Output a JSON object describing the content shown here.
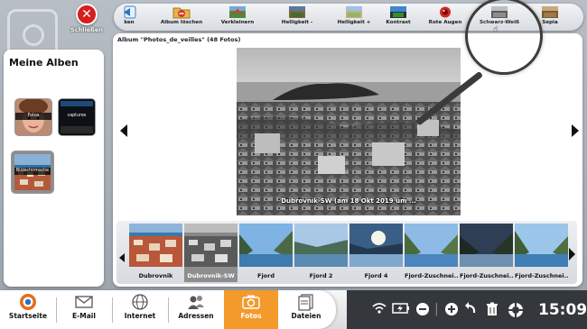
{
  "window": {
    "close_label": "Schließen"
  },
  "toolbar": {
    "items": [
      {
        "label": "ken",
        "icon": "back-arrow-icon"
      },
      {
        "label": "Album löschen",
        "icon": "folder-delete-icon"
      },
      {
        "label": "Verkleinern",
        "icon": "resize-icon"
      },
      {
        "label": "Helligkeit -",
        "icon": "brightness-down-icon"
      },
      {
        "label": "Helligkeit +",
        "icon": "brightness-up-icon"
      },
      {
        "label": "Kontrast",
        "icon": "contrast-icon"
      },
      {
        "label": "Rote Augen",
        "icon": "red-eye-icon"
      },
      {
        "label": "Schwarz-Weiß",
        "icon": "black-white-icon"
      },
      {
        "label": "Sepia",
        "icon": "sepia-icon"
      }
    ]
  },
  "sidebar": {
    "title": "Meine Alben",
    "albums": [
      {
        "label": "Fotos"
      },
      {
        "label": "captures"
      },
      {
        "label": "Bildschirmsche"
      }
    ]
  },
  "main": {
    "album_title": "Album \"Photos_de_veilles\" (48 Fotos)",
    "photo_caption": "Dubrovnik-SW (am 18 Okt 2019 um ..."
  },
  "thumbnails": [
    {
      "label": "Dubrovnik"
    },
    {
      "label": "Dubrovnik-SW"
    },
    {
      "label": "Fjord"
    },
    {
      "label": "Fjord 2"
    },
    {
      "label": "Fjord 4"
    },
    {
      "label": "Fjord-Zuschnei..."
    },
    {
      "label": "Fjord-Zuschnei..."
    },
    {
      "label": "Fjord-Zuschnei..."
    }
  ],
  "taskbar": {
    "apps": [
      {
        "label": "Startseite",
        "icon": "home-logo-icon"
      },
      {
        "label": "E-Mail",
        "icon": "envelope-icon"
      },
      {
        "label": "Internet",
        "icon": "globe-icon"
      },
      {
        "label": "Adressen",
        "icon": "contacts-icon"
      },
      {
        "label": "Fotos",
        "icon": "camera-icon"
      },
      {
        "label": "Dateien",
        "icon": "files-icon"
      }
    ],
    "active_app": "Fotos",
    "time": "15:09"
  },
  "colors": {
    "accent": "#f39a2a",
    "close_red": "#d71d1d"
  }
}
